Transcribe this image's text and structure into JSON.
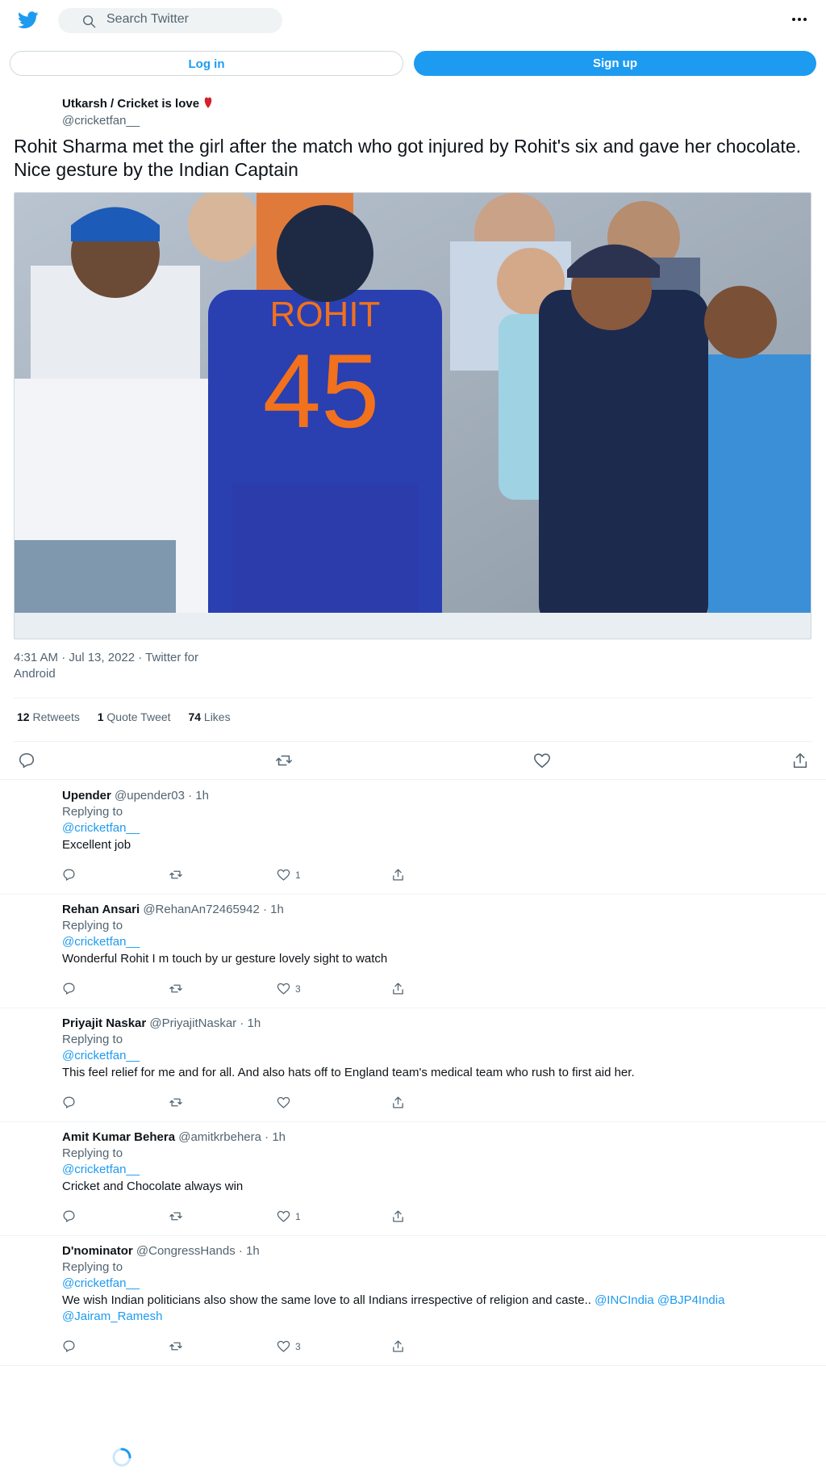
{
  "header": {
    "search_placeholder": "Search Twitter",
    "login_label": "Log in",
    "signup_label": "Sign up"
  },
  "tweet": {
    "author_name": "Utkarsh / Cricket is love",
    "author_handle": "@cricketfan__",
    "text": "Rohit Sharma met the girl after the match who got injured by Rohit's six and gave her chocolate. Nice gesture by the Indian Captain",
    "timestamp": "4:31 AM · Jul 13, 2022 · Twitter for Android",
    "retweets": "12",
    "retweets_label": "Retweets",
    "quotes": "1",
    "quotes_label": "Quote Tweet",
    "likes": "74",
    "likes_label": "Likes"
  },
  "replies": [
    {
      "name": "Upender",
      "sub": "@upender03 · 1h",
      "replying_label": "Replying to",
      "replying_to": "@cricketfan__",
      "text": "Excellent job",
      "likes": "1"
    },
    {
      "name": "Rehan Ansari",
      "sub": "@RehanAn72465942 · 1h",
      "replying_label": "Replying to",
      "replying_to": "@cricketfan__",
      "text": "Wonderful Rohit I m touch by ur gesture lovely sight to watch",
      "likes": "3"
    },
    {
      "name": "Priyajit Naskar",
      "sub": "@PriyajitNaskar · 1h",
      "replying_label": "Replying to",
      "replying_to": "@cricketfan__",
      "text": "This feel relief for me and for all. And also hats off to England team's medical team who rush to first aid her.",
      "likes": ""
    },
    {
      "name": "Amit Kumar Behera",
      "sub": "@amitkrbehera · 1h",
      "replying_label": "Replying to",
      "replying_to": "@cricketfan__",
      "text": "Cricket and Chocolate always win",
      "likes": "1"
    },
    {
      "name": "D'nominator",
      "sub": "@CongressHands · 1h",
      "replying_label": "Replying to",
      "replying_to": "@cricketfan__",
      "text": "We wish Indian politicians also show the same love to all Indians irrespective of religion and caste..",
      "mentions": [
        "@INCIndia",
        "@BJP4India",
        "@Jairam_Ramesh"
      ],
      "likes": "3"
    }
  ],
  "colors": {
    "accent": "#1d9bf0",
    "text": "#0f1419",
    "muted": "#536471",
    "border": "#eff3f4",
    "heart": "#d5202e"
  },
  "icons": [
    "twitter-bird-icon",
    "search-icon",
    "more-icon",
    "heart-emoji-icon",
    "reply-icon",
    "retweet-icon",
    "like-icon",
    "share-icon",
    "loading-spinner-icon"
  ]
}
